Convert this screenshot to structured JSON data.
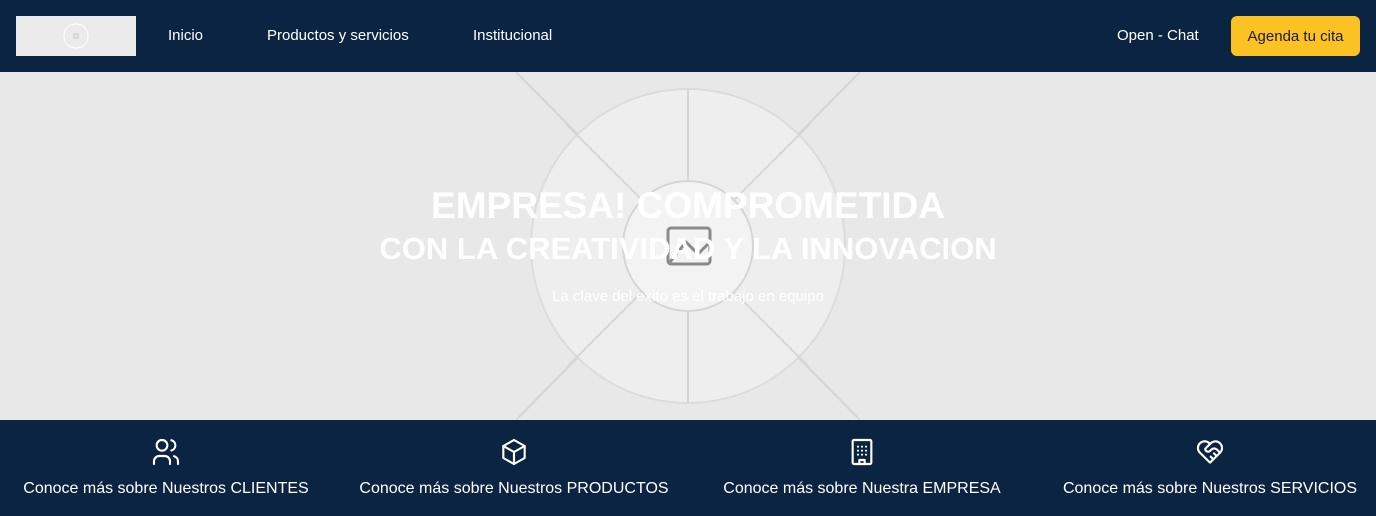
{
  "header": {
    "nav": [
      {
        "label": "Inicio"
      },
      {
        "label": "Productos y servicios"
      },
      {
        "label": "Institucional"
      }
    ],
    "chat_label": "Open - Chat",
    "cta_label": "Agenda tu cita"
  },
  "hero": {
    "title_line1": "EMPRESA! COMPROMETIDA",
    "title_line2": "CON LA CREATIVIDAD Y LA INNOVACION",
    "subtitle": "La clave del exito es el trabajo en equipo"
  },
  "features": [
    {
      "icon": "users-icon",
      "label": "Conoce más sobre Nuestros CLIENTES"
    },
    {
      "icon": "cube-icon",
      "label": "Conoce más sobre Nuestros PRODUCTOS"
    },
    {
      "icon": "building-icon",
      "label": "Conoce más sobre Nuestra EMPRESA"
    },
    {
      "icon": "heart-handshake-icon",
      "label": "Conoce más sobre Nuestros SERVICIOS"
    }
  ],
  "colors": {
    "navy": "#0b2442",
    "accent": "#fbc224",
    "hero_bg": "#e8e8e8"
  }
}
